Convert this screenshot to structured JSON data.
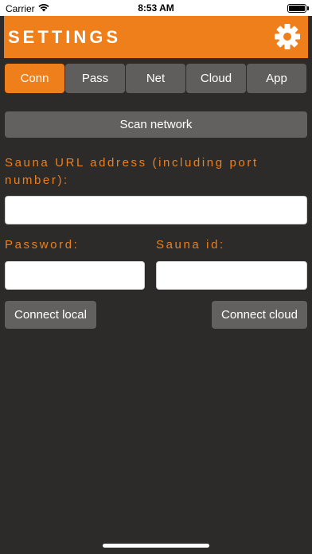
{
  "status_bar": {
    "carrier": "Carrier",
    "time": "8:53 AM",
    "battery_level": 1.0
  },
  "header": {
    "title": "SETTINGS",
    "settings_icon": "gear-icon",
    "background_color": "#ef7f1a"
  },
  "tabs": [
    {
      "label": "Conn",
      "active": true
    },
    {
      "label": "Pass",
      "active": false
    },
    {
      "label": "Net",
      "active": false
    },
    {
      "label": "Cloud",
      "active": false
    },
    {
      "label": "App",
      "active": false
    }
  ],
  "connection": {
    "scan_button": "Scan network",
    "url_label": "Sauna URL address (including port number):",
    "url_value": "",
    "password_label": "Password:",
    "password_value": "",
    "sauna_id_label": "Sauna id:",
    "sauna_id_value": "",
    "connect_local_button": "Connect local",
    "connect_cloud_button": "Connect cloud"
  },
  "colors": {
    "accent": "#ef7f1a",
    "background": "#2c2b29",
    "button": "#626160"
  }
}
